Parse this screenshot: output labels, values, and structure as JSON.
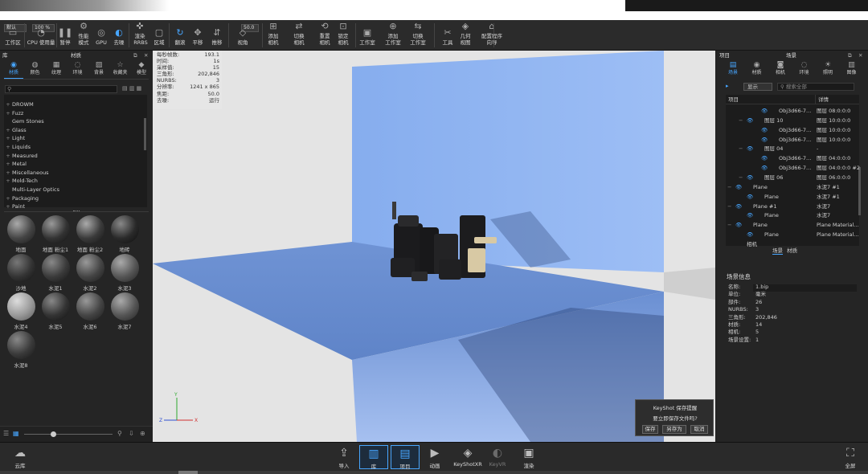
{
  "toolbar": {
    "field1": "默认",
    "zoom": "100 %",
    "focal": "50.0",
    "buttons": [
      {
        "icon": "workspace-icon",
        "label": "工作区"
      },
      {
        "icon": "cpu-usage-icon",
        "label": "CPU 使用量"
      },
      {
        "icon": "pause-icon",
        "label": "暂停"
      },
      {
        "icon": "performance-icon",
        "label": "性能\n模式"
      },
      {
        "icon": "gpu-icon",
        "label": "GPU"
      },
      {
        "icon": "denoise-icon",
        "label": "去噪"
      },
      {
        "icon": "render-region-icon",
        "label": "渲染\n RRBS"
      },
      {
        "icon": "region-icon",
        "label": "区域"
      },
      {
        "icon": "tumble-icon",
        "label": "翻滚"
      },
      {
        "icon": "pan-icon",
        "label": "平移"
      },
      {
        "icon": "dolly-icon",
        "label": "推移"
      },
      {
        "icon": "view-angle-icon",
        "label": "视角"
      },
      {
        "icon": "add-camera-icon",
        "label": "添加\n相机"
      },
      {
        "icon": "switch-camera-icon",
        "label": "切换\n相机"
      },
      {
        "icon": "reset-camera-icon",
        "label": "重置\n相机"
      },
      {
        "icon": "lock-camera-icon",
        "label": "锁定\n相机"
      },
      {
        "icon": "studio-icon",
        "label": "工作室"
      },
      {
        "icon": "add-studio-icon",
        "label": "添加\n工作室"
      },
      {
        "icon": "switch-studio-icon",
        "label": "切换\n工作室"
      },
      {
        "icon": "tools-icon",
        "label": "工具"
      },
      {
        "icon": "geometry-view-icon",
        "label": "几何\n视图"
      },
      {
        "icon": "configurator-icon",
        "label": "配置程序\n向导"
      }
    ]
  },
  "library": {
    "title_left": "库",
    "title": "材质",
    "tabs": [
      {
        "icon": "material-icon",
        "label": "材质"
      },
      {
        "icon": "color-icon",
        "label": "颜色"
      },
      {
        "icon": "texture-icon",
        "label": "纹理"
      },
      {
        "icon": "environment-icon",
        "label": "环境"
      },
      {
        "icon": "backplate-icon",
        "label": "背景"
      },
      {
        "icon": "favorites-icon",
        "label": "收藏夹"
      },
      {
        "icon": "model-icon",
        "label": "模型"
      }
    ],
    "tree": [
      {
        "label": "DROWM",
        "expand": "+"
      },
      {
        "label": "Fuzz",
        "expand": "+"
      },
      {
        "label": "Gem Stones",
        "expand": ""
      },
      {
        "label": "Glass",
        "expand": "+"
      },
      {
        "label": "Light",
        "expand": "+"
      },
      {
        "label": "Liquids",
        "expand": "+"
      },
      {
        "label": "Measured",
        "expand": "+"
      },
      {
        "label": "Metal",
        "expand": "+"
      },
      {
        "label": "Miscellaneous",
        "expand": "+"
      },
      {
        "label": "Mold-Tech",
        "expand": "+"
      },
      {
        "label": "Multi-Layer Optics",
        "expand": ""
      },
      {
        "label": "Packaging",
        "expand": "+"
      },
      {
        "label": "Paint",
        "expand": "+"
      }
    ],
    "materials": [
      "地面",
      "地面 粉尘1",
      "地面 粉尘2",
      "地砖",
      "沙地",
      "水泥1",
      "水泥2",
      "水泥3",
      "水泥4",
      "水泥5",
      "水泥6",
      "水泥7",
      "水泥8"
    ]
  },
  "hud": [
    {
      "k": "每秒帧数:",
      "v": "193.1"
    },
    {
      "k": "时间:",
      "v": "1s"
    },
    {
      "k": "采样值:",
      "v": "15"
    },
    {
      "k": "三角形:",
      "v": "202,846"
    },
    {
      "k": "NURBS:",
      "v": "3"
    },
    {
      "k": "分辨率:",
      "v": "1241 x 865"
    },
    {
      "k": "焦距:",
      "v": "50.0"
    },
    {
      "k": "去噪:",
      "v": "运行"
    }
  ],
  "right": {
    "title_left": "项目",
    "title": "场景",
    "tabs": [
      {
        "icon": "scene-icon",
        "label": "场景"
      },
      {
        "icon": "material-icon",
        "label": "材质"
      },
      {
        "icon": "camera-icon",
        "label": "相机"
      },
      {
        "icon": "environment-icon",
        "label": "环境"
      },
      {
        "icon": "lighting-icon",
        "label": "照明"
      },
      {
        "icon": "image-icon",
        "label": "图像"
      }
    ],
    "filter": "显示",
    "search_placeholder": "搜索全部",
    "col_item": "项目",
    "col_detail": "详情",
    "rows": [
      {
        "name": "Obj3d66-7...",
        "detail": "图层 08:0:0:0"
      },
      {
        "name": "图层 10",
        "detail": "图层 10:0:0:0"
      },
      {
        "name": "Obj3d66-7...",
        "detail": "图层 10:0:0:0"
      },
      {
        "name": "Obj3d66-7...",
        "detail": "图层 10:0:0:0"
      },
      {
        "name": "图层 04",
        "detail": "-"
      },
      {
        "name": "Obj3d66-7...",
        "detail": "图层 04:0:0:0"
      },
      {
        "name": "Obj3d66-7...",
        "detail": "图层 04:0:0:0 #2"
      },
      {
        "name": "图层 06",
        "detail": "图层 06:0:0:0"
      },
      {
        "name": "Plane",
        "detail": "水泥7 #1"
      },
      {
        "name": "Plane",
        "detail": "水泥7 #1"
      },
      {
        "name": "Plane #1",
        "detail": "水泥7"
      },
      {
        "name": "Plane",
        "detail": "水泥7"
      },
      {
        "name": "Plane",
        "detail": "Plane Material..."
      },
      {
        "name": "Plane",
        "detail": "Plane Material..."
      },
      {
        "name": "相机",
        "detail": ""
      }
    ],
    "subtab_scene": "场景",
    "subtab_material": "材质",
    "info_title": "场景信息",
    "info": [
      {
        "k": "名称:",
        "v": "1.bip"
      },
      {
        "k": "单位:",
        "v": "毫米"
      },
      {
        "k": "部件:",
        "v": "26"
      },
      {
        "k": "NURBS:",
        "v": "3"
      },
      {
        "k": "三角形:",
        "v": "202,846"
      },
      {
        "k": "材质:",
        "v": "14"
      },
      {
        "k": "相机:",
        "v": "5"
      },
      {
        "k": "场景设置:",
        "v": "1"
      }
    ]
  },
  "dialog": {
    "title": "KeyShot 保存提醒",
    "message": "要立即保存文件吗?",
    "save": "保存",
    "save_as": "另存为",
    "cancel": "取消"
  },
  "bottom": {
    "cloud": "云库",
    "fullscreen": "全屏",
    "buttons": [
      {
        "icon": "import-icon",
        "label": "导入"
      },
      {
        "icon": "library-icon",
        "label": "库"
      },
      {
        "icon": "project-icon",
        "label": "项目"
      },
      {
        "icon": "animation-icon",
        "label": "动画"
      },
      {
        "icon": "keyshotxr-icon",
        "label": "KeyShotXR"
      },
      {
        "icon": "keyvr-icon",
        "label": "KeyVR"
      },
      {
        "icon": "render-icon",
        "label": "渲染"
      }
    ]
  },
  "colors": {
    "accent": "#47a6ff",
    "panel": "#252525",
    "backdrop": "#7fa6e8"
  }
}
